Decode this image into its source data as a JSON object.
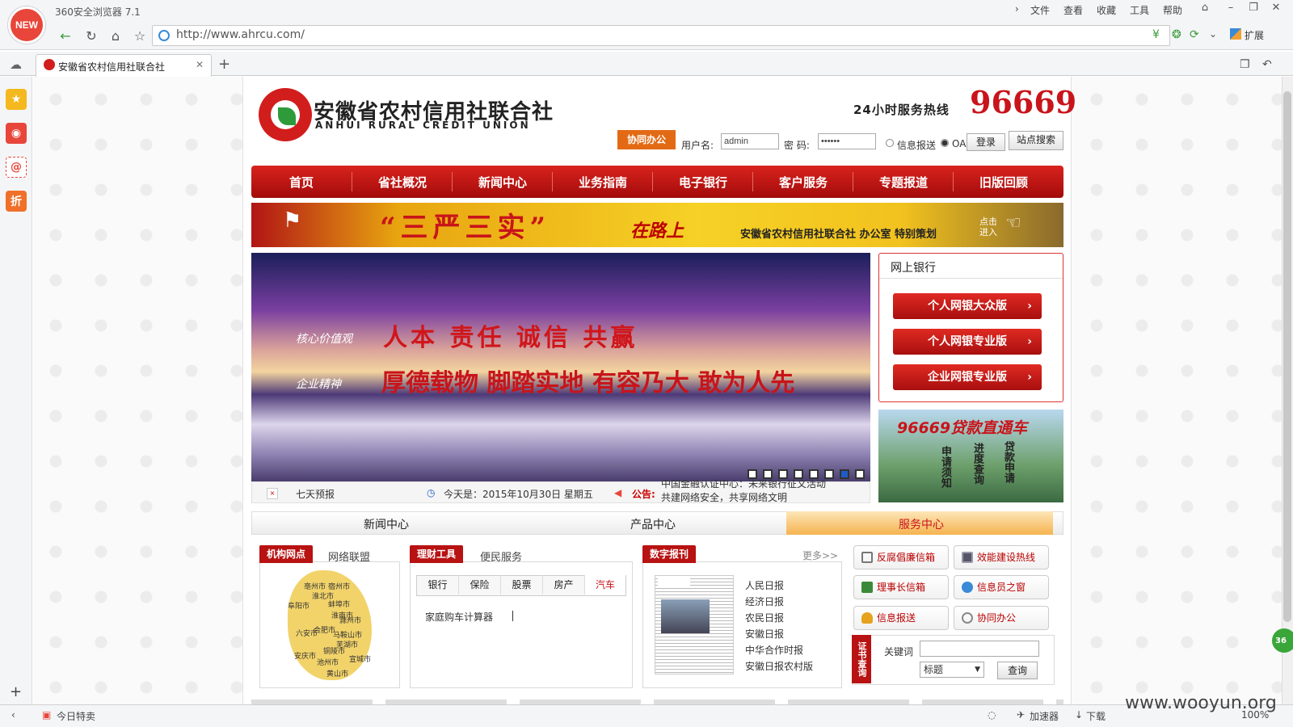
{
  "browser": {
    "title": "360安全浏览器 7.1",
    "badge": "NEW",
    "menu": [
      "文件",
      "查看",
      "收藏",
      "工具",
      "帮助"
    ],
    "url": "http://www.ahrcu.com/",
    "extensions_label": "扩展",
    "tab_title": "安徽省农村信用社联合社",
    "sidebar_icons": [
      "star-icon",
      "weibo-icon",
      "mail-icon",
      "discount-icon"
    ],
    "sidebar_discount": "折",
    "statusbar": {
      "today_deal": "今日特卖",
      "accelerator": "加速器",
      "download": "下载",
      "zoom": "100%"
    }
  },
  "site": {
    "name_cn": "安徽省农村信用社联合社",
    "name_en": "ANHUI RURAL CREDIT UNION",
    "hotline_label": "24小时服务热线",
    "hotline_number": "96669",
    "login": {
      "coop_label": "协同办公",
      "username_label": "用户名:",
      "username_value": "admin",
      "password_label": "密 码:",
      "password_value": "••••••",
      "radio_info": "信息报送",
      "radio_oa": "OA",
      "login_button": "登录",
      "search_button": "站点搜索"
    },
    "nav": [
      "首页",
      "省社概况",
      "新闻中心",
      "业务指南",
      "电子银行",
      "客户服务",
      "专题报道",
      "旧版回顾"
    ],
    "banner": {
      "quote": "“三严三实”",
      "road": "在路上",
      "org": "安徽省农村信用社联合社  办公室  特别策划",
      "click": "点击进入"
    },
    "slide": {
      "label1": "核心价值观",
      "slogan1": "人本  责任  诚信  共赢",
      "label2": "企业精神",
      "slogan2": "厚德载物 脚踏实地 有容乃大 敢为人先",
      "dots": 8,
      "active_dot": 6
    },
    "infobar": {
      "forecast": "七天预报",
      "today": "今天是：2015年10月30日  星期五",
      "notice_label": "公告:",
      "notice_line1": "中国金融认证中心：未来银行征文活动",
      "notice_line2": "共建网络安全，共享网络文明"
    },
    "netbank": {
      "title": "网上银行",
      "buttons": [
        "个人网银大众版",
        "个人网银专业版",
        "企业网银专业版"
      ]
    },
    "loan": {
      "title": "96669贷款直通车",
      "items": [
        "申请须知",
        "进度查询",
        "贷款申请"
      ]
    },
    "main_tabs": [
      "新闻中心",
      "产品中心",
      "服务中心"
    ],
    "outlets": {
      "tag": "机构网点",
      "tab2": "网络联盟",
      "cities": [
        "亳州市",
        "宿州市",
        "淮北市",
        "蚌埠市",
        "阜阳市",
        "淮南市",
        "滁州市",
        "六安市",
        "合肥市",
        "马鞍山市",
        "芜湖市",
        "安庆市",
        "铜陵市",
        "池州市",
        "宣城市",
        "黄山市"
      ]
    },
    "finance": {
      "tag": "理财工具",
      "tab2": "便民服务",
      "subtabs": [
        "银行",
        "保险",
        "股票",
        "房产",
        "汽车"
      ],
      "tool": "家庭购车计算器"
    },
    "digital": {
      "tag": "数字报刊",
      "more": "更多>>",
      "papers": [
        "人民日报",
        "经济日报",
        "农民日报",
        "安徽日报",
        "中华合作时报",
        "安徽日报农村版"
      ]
    },
    "service": {
      "buttons": [
        "反腐倡廉信箱",
        "效能建设热线",
        "理事长信箱",
        "信息员之窗",
        "信息报送",
        "协同办公"
      ],
      "cert_label": "证书查询",
      "keyword_label": "关键词",
      "select_value": "标题",
      "query_button": "查询"
    },
    "watermark": "www.wooyun.org"
  }
}
